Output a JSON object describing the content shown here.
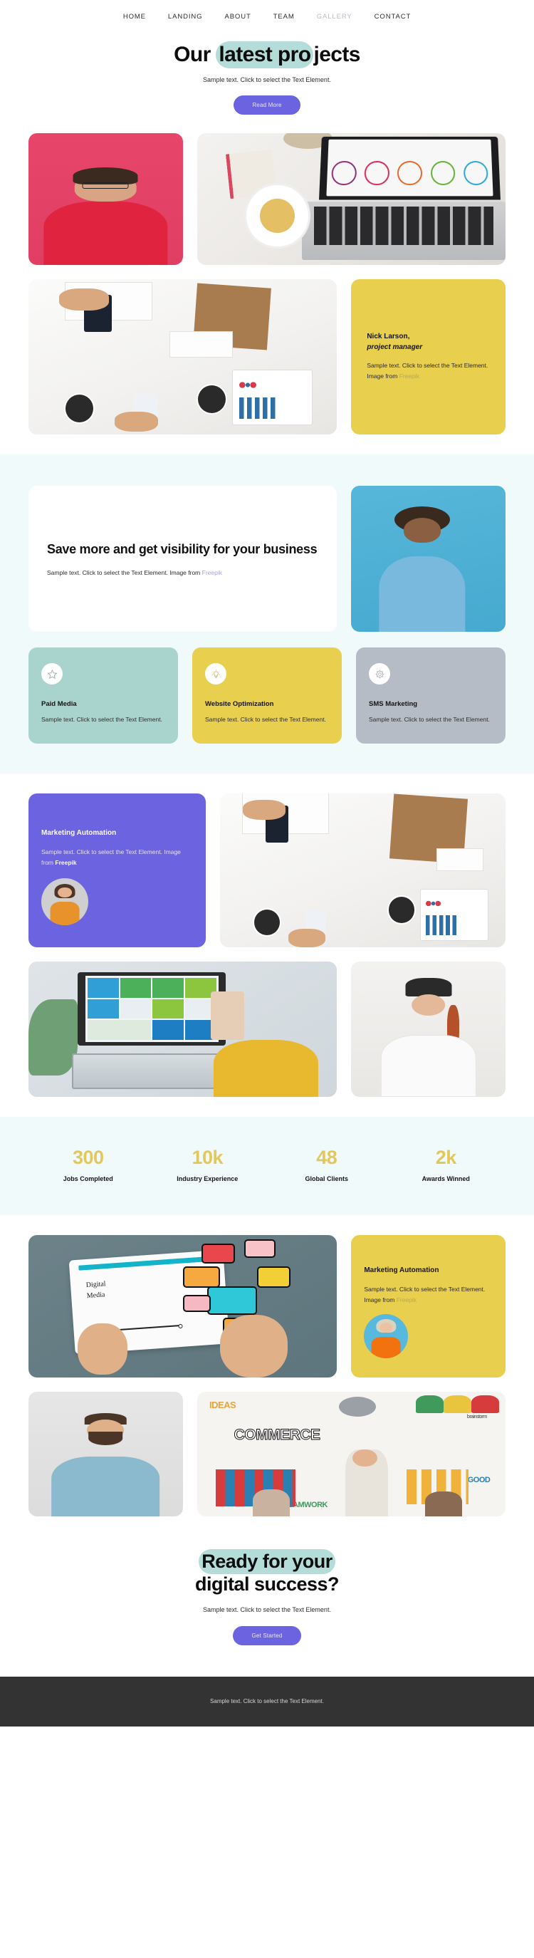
{
  "nav": {
    "items": [
      {
        "label": "HOME",
        "active": false
      },
      {
        "label": "LANDING",
        "active": false
      },
      {
        "label": "ABOUT",
        "active": false
      },
      {
        "label": "TEAM",
        "active": false
      },
      {
        "label": "GALLERY",
        "active": true
      },
      {
        "label": "CONTACT",
        "active": false
      }
    ]
  },
  "hero": {
    "title_pre": "Our ",
    "title_highlight": "latest pro",
    "title_post": "jects",
    "subtitle": "Sample text. Click to select the Text Element.",
    "button": "Read More",
    "highlight_color": "#b4dcd8",
    "button_color": "#6c63e0"
  },
  "gallery1": {
    "cards": {
      "nick": {
        "name_line1": "Nick Larson,",
        "name_line2": "project manager",
        "body": "Sample text. Click to select the Text Element. Image from ",
        "link": "Freepik",
        "bg": "#e8cf4e"
      }
    },
    "images": [
      {
        "alt": "man-in-red-sweater-ok-gesture"
      },
      {
        "alt": "hands-typing-laptop-marketing-funnel"
      },
      {
        "alt": "team-overhead-desk-phones-tablet"
      }
    ]
  },
  "save_section": {
    "title": "Save more and get visibility for your business",
    "body": "Sample text. Click to select the Text Element. Image from ",
    "link": "Freepik",
    "bg": "#f1fafa",
    "image_alt": "smiling-woman-blue-turtleneck"
  },
  "features": [
    {
      "title": "Paid Media",
      "body": "Sample text. Click to select the Text Element.",
      "bg": "#a9d3cd",
      "icon": "star-icon"
    },
    {
      "title": "Website Optimization",
      "body": "Sample text. Click to select the Text Element.",
      "bg": "#e8cf4e",
      "icon": "lightbulb-icon"
    },
    {
      "title": "SMS Marketing",
      "body": "Sample text. Click to select the Text Element.",
      "bg": "#b6bcc6",
      "icon": "gear-icon"
    }
  ],
  "gallery2": {
    "card": {
      "title": "Marketing Automation",
      "body": "Sample text. Click to select the Text Element. Image from ",
      "link": "Freepik",
      "bg": "#6c63e0",
      "avatar_alt": "woman-orange-top-arms-crossed"
    },
    "images": [
      {
        "alt": "team-overhead-desk-phones-tablet"
      },
      {
        "alt": "hands-typing-laptop-dashboard"
      },
      {
        "alt": "woman-beanie-braid-smiling"
      }
    ]
  },
  "stats": [
    {
      "value": "300",
      "label": "Jobs Completed"
    },
    {
      "value": "10k",
      "label": "Industry Experience"
    },
    {
      "value": "48",
      "label": "Global Clients"
    },
    {
      "value": "2k",
      "label": "Awards Winned"
    }
  ],
  "stats_style": {
    "number_color": "#e3c75a",
    "bg": "#f1fafa"
  },
  "gallery3": {
    "card": {
      "title": "Marketing Automation",
      "body": "Sample text. Click to select the Text Element. Image from ",
      "link": "Freepik",
      "bg": "#e8cf4e",
      "avatar_alt": "mature-woman-orange-sweater-blue-bg"
    },
    "images": [
      {
        "alt": "hands-holding-tablet-digital-media",
        "caption_line1": "Digital",
        "caption_line2": "Media"
      },
      {
        "alt": "bearded-man-light-blue-shirt"
      },
      {
        "alt": "man-presenting-commerce-whiteboard",
        "words": [
          "IDEAS",
          "COMMERCE",
          "TEAMWORK",
          "GOOD",
          "brainstorm"
        ]
      }
    ]
  },
  "cta": {
    "title_line1_highlight": "Ready for your",
    "title_line2": "digital success?",
    "subtitle": "Sample text. Click to select the Text Element.",
    "button": "Get Started"
  },
  "footer": {
    "text": "Sample text. Click to select the Text Element.",
    "bg": "#333333"
  }
}
